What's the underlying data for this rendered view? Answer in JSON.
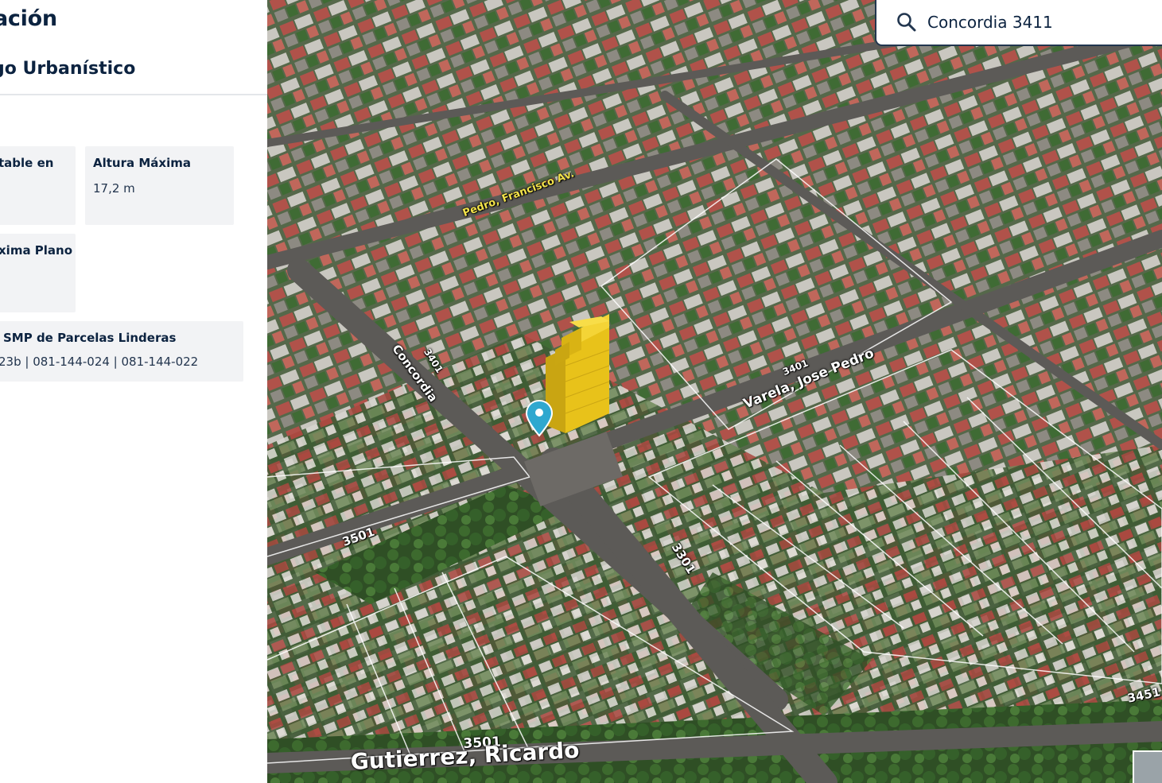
{
  "panel": {
    "title": "ación",
    "subtitle": "go Urbanístico",
    "cards": {
      "edificable": {
        "label": "table en",
        "value": ""
      },
      "altura": {
        "label": "Altura Máxima",
        "value": "17,2 m"
      },
      "plano": {
        "label": "xima Plano",
        "value": ""
      },
      "smp": {
        "label": "SMP de Parcelas Linderas",
        "value": "23b | 081-144-024 | 081-144-022"
      }
    }
  },
  "search": {
    "value": "Concordia 3411",
    "icon": "search-icon"
  },
  "map": {
    "streets": {
      "pedro": "Pedro, Francisco Av.",
      "concordia": "Concordia",
      "n3401_a": "3401",
      "n3401_b": "3401",
      "varela": "Varela, Jose Pedro",
      "n3501_a": "3501",
      "n3301": "3301",
      "n3501_b": "3501",
      "gutierrez": "Gutierrez, Ricardo",
      "n3451": "3451"
    },
    "marker_icon": "location-pin-icon",
    "building_color": "#e8c21a",
    "marker_color": "#2fa8cf"
  }
}
